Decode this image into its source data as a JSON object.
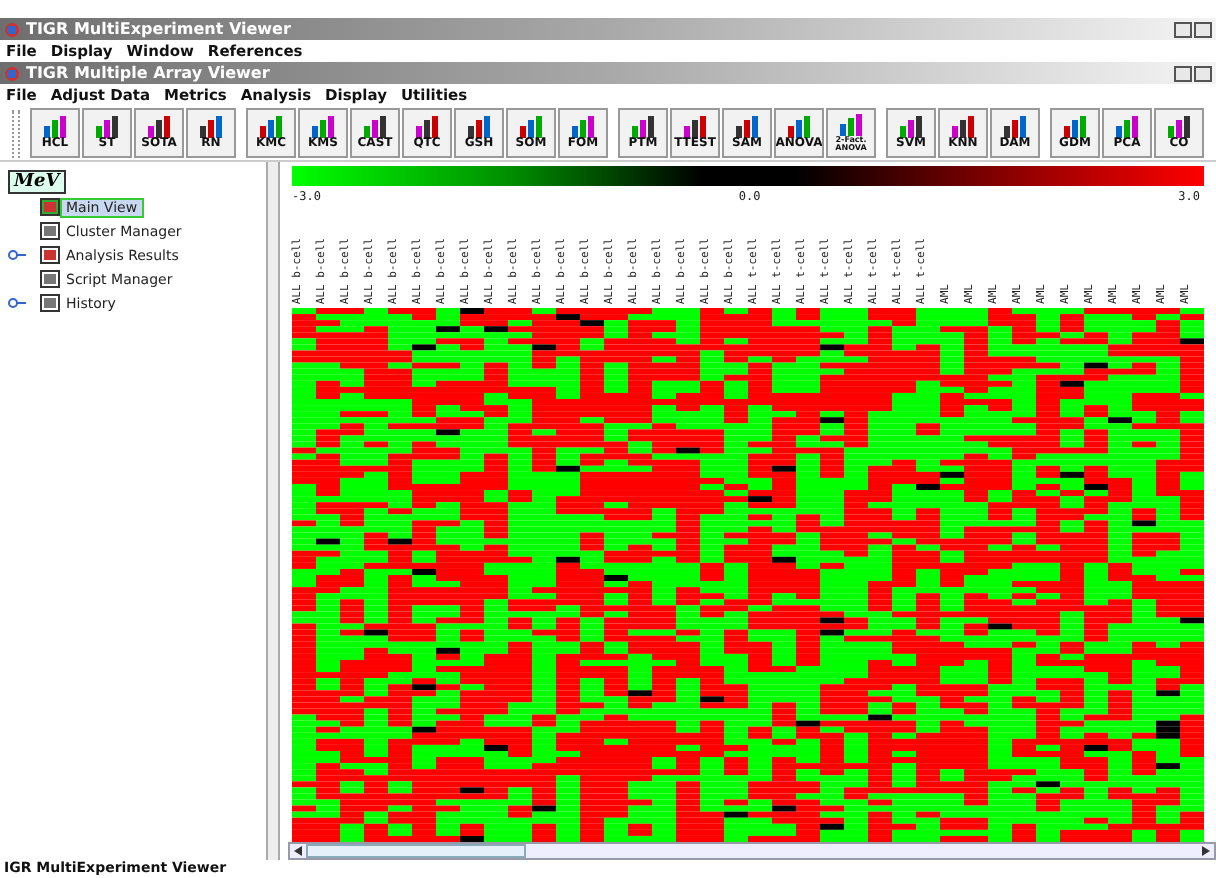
{
  "outer_window": {
    "title": "TIGR MultiExperiment Viewer",
    "menu": [
      "File",
      "Display",
      "Window",
      "References"
    ]
  },
  "inner_window": {
    "title": "TIGR Multiple Array Viewer",
    "menu": [
      "File",
      "Adjust Data",
      "Metrics",
      "Analysis",
      "Display",
      "Utilities"
    ]
  },
  "toolbar_groups": [
    [
      "HCL",
      "ST",
      "SOTA",
      "RN"
    ],
    [
      "KMC",
      "KMS",
      "CAST",
      "QTC",
      "GSH",
      "SOM",
      "FOM"
    ],
    [
      "PTM",
      "TTEST",
      "SAM",
      "ANOVA",
      "2-Fact. ANOVA"
    ],
    [
      "SVM",
      "KNN",
      "DAM"
    ],
    [
      "GDM",
      "PCA",
      "CO"
    ]
  ],
  "tree": {
    "logo": "MeV",
    "items": [
      {
        "label": "Main View",
        "selected": true,
        "expandable": false
      },
      {
        "label": "Cluster Manager",
        "selected": false,
        "expandable": false
      },
      {
        "label": "Analysis Results",
        "selected": false,
        "expandable": true
      },
      {
        "label": "Script Manager",
        "selected": false,
        "expandable": false
      },
      {
        "label": "History",
        "selected": false,
        "expandable": true
      }
    ]
  },
  "color_scale": {
    "min": "-3.0",
    "mid": "0.0",
    "max": "3.0"
  },
  "samples": [
    "ALL b-cell",
    "ALL b-cell",
    "ALL b-cell",
    "ALL b-cell",
    "ALL b-cell",
    "ALL b-cell",
    "ALL b-cell",
    "ALL b-cell",
    "ALL b-cell",
    "ALL b-cell",
    "ALL b-cell",
    "ALL b-cell",
    "ALL b-cell",
    "ALL b-cell",
    "ALL b-cell",
    "ALL b-cell",
    "ALL b-cell",
    "ALL b-cell",
    "ALL b-cell",
    "ALL t-cell",
    "ALL t-cell",
    "ALL t-cell",
    "ALL t-cell",
    "ALL t-cell",
    "ALL t-cell",
    "ALL t-cell",
    "ALL t-cell",
    "AML",
    "AML",
    "AML",
    "AML",
    "AML",
    "AML",
    "AML",
    "AML",
    "AML",
    "AML",
    "AML"
  ],
  "status_bar": "IGR MultiExperiment Viewer"
}
